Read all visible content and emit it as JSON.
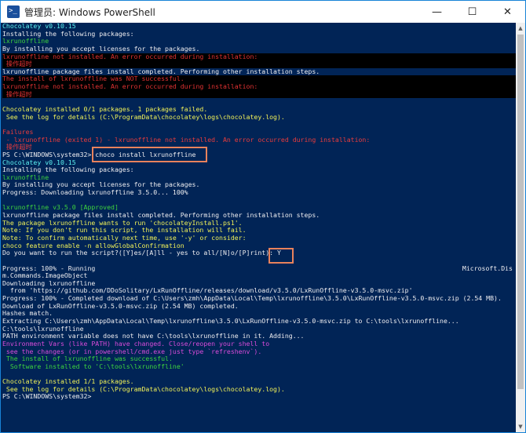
{
  "window": {
    "title": "管理员: Windows PowerShell",
    "controls": [
      "—",
      "☐",
      "✕"
    ]
  },
  "colors": {
    "background": "#012456",
    "text": "#eeedf0",
    "cyan": "#5ef2f2",
    "green": "#3ed33e",
    "yellow": "#f1f158",
    "red": "#ea3c3c",
    "magenta": "#d94bd9",
    "highlight_box": "#e8825c"
  },
  "terminal": {
    "lines": [
      {
        "text": "Chocolatey v0.10.15",
        "style": "cyan"
      },
      {
        "text": "Installing the following packages:",
        "style": "white"
      },
      {
        "text": "lxrunoffline",
        "style": "green"
      },
      {
        "text": "By installing you accept licenses for the packages.",
        "style": "white"
      },
      {
        "text": "lxrunoffline not installed. An error occurred during installation:",
        "style": "err"
      },
      {
        "text": " 操作超时",
        "style": "err"
      },
      {
        "text": "lxrunoffline package files install completed. Performing other installation steps.",
        "style": "white"
      },
      {
        "text": "The install of lxrunoffline was NOT successful.",
        "style": "err"
      },
      {
        "text": "lxrunoffline not installed. An error occurred during installation:",
        "style": "err"
      },
      {
        "text": " 操作超时",
        "style": "err"
      },
      {
        "text": "",
        "style": "blank"
      },
      {
        "text": "Chocolatey installed 0/1 packages. 1 packages failed.",
        "style": "yellow"
      },
      {
        "text": " See the log for details (C:\\ProgramData\\chocolatey\\logs\\chocolatey.log).",
        "style": "yellow"
      },
      {
        "text": "",
        "style": "blank"
      },
      {
        "text": "Failures",
        "style": "red"
      },
      {
        "text": " - lxrunoffline (exited 1) - lxrunoffline not installed. An error occurred during installation:",
        "style": "red"
      },
      {
        "text": " 操作超时",
        "style": "red"
      },
      {
        "text": "PS C:\\WINDOWS\\system32> choco install lxrunoffline",
        "style": "white"
      },
      {
        "text": "Chocolatey v0.10.15",
        "style": "cyan"
      },
      {
        "text": "Installing the following packages:",
        "style": "white"
      },
      {
        "text": "lxrunoffline",
        "style": "green"
      },
      {
        "text": "By installing you accept licenses for the packages.",
        "style": "white"
      },
      {
        "text": "Progress: Downloading lxrunoffline 3.5.0... 100%",
        "style": "white"
      },
      {
        "text": "",
        "style": "blank"
      },
      {
        "text": "lxrunoffline v3.5.0 [Approved]",
        "style": "green"
      },
      {
        "text": "lxrunoffline package files install completed. Performing other installation steps.",
        "style": "white"
      },
      {
        "text": "The package lxrunoffline wants to run 'chocolateyInstall.ps1'.",
        "style": "yellow"
      },
      {
        "text": "Note: If you don't run this script, the installation will fail.",
        "style": "yellow"
      },
      {
        "text": "Note: To confirm automatically next time, use '-y' or consider:",
        "style": "yellow"
      },
      {
        "text": "choco feature enable -n allowGlobalConfirmation",
        "style": "yellow"
      },
      {
        "text": "Do you want to run the script?([Y]es/[A]ll - yes to all/[N]o/[P]rint): Y",
        "style": "white"
      },
      {
        "text": "",
        "style": "blank"
      },
      {
        "text": "Progress: 100% - Running",
        "style": "white",
        "right": "Microsoft.Dis"
      },
      {
        "text": "m.Commands.ImageObject",
        "style": "white"
      },
      {
        "text": "Downloading lxrunoffline",
        "style": "white"
      },
      {
        "text": "  from 'https://github.com/DDoSolitary/LxRunOffline/releases/download/v3.5.0/LxRunOffline-v3.5.0-msvc.zip'",
        "style": "white"
      },
      {
        "text": "Progress: 100% - Completed download of C:\\Users\\zmh\\AppData\\Local\\Temp\\lxrunoffline\\3.5.0\\LxRunOffline-v3.5.0-msvc.zip (2.54 MB).",
        "style": "white"
      },
      {
        "text": "Download of LxRunOffline-v3.5.0-msvc.zip (2.54 MB) completed.",
        "style": "white"
      },
      {
        "text": "Hashes match.",
        "style": "white"
      },
      {
        "text": "Extracting C:\\Users\\zmh\\AppData\\Local\\Temp\\lxrunoffline\\3.5.0\\LxRunOffline-v3.5.0-msvc.zip to C:\\tools\\lxrunoffline...",
        "style": "white"
      },
      {
        "text": "C:\\tools\\lxrunoffline",
        "style": "white"
      },
      {
        "text": "PATH environment variable does not have C:\\tools\\lxrunoffline in it. Adding...",
        "style": "white"
      },
      {
        "text": "Environment Vars (like PATH) have changed. Close/reopen your shell to",
        "style": "magenta"
      },
      {
        "text": " see the changes (or in powershell/cmd.exe just type `refreshenv`).",
        "style": "magenta"
      },
      {
        "text": " The install of lxrunoffline was successful.",
        "style": "green"
      },
      {
        "text": "  Software installed to 'C:\\tools\\lxrunoffline'",
        "style": "green"
      },
      {
        "text": "",
        "style": "blank"
      },
      {
        "text": "Chocolatey installed 1/1 packages.",
        "style": "yellow"
      },
      {
        "text": " See the log for details (C:\\ProgramData\\chocolatey\\logs\\chocolatey.log).",
        "style": "yellow"
      },
      {
        "text": "PS C:\\WINDOWS\\system32>",
        "style": "white"
      }
    ]
  },
  "annotations": {
    "command_box_label": "choco install lxrunoffline",
    "answer_box_label": "Y"
  }
}
